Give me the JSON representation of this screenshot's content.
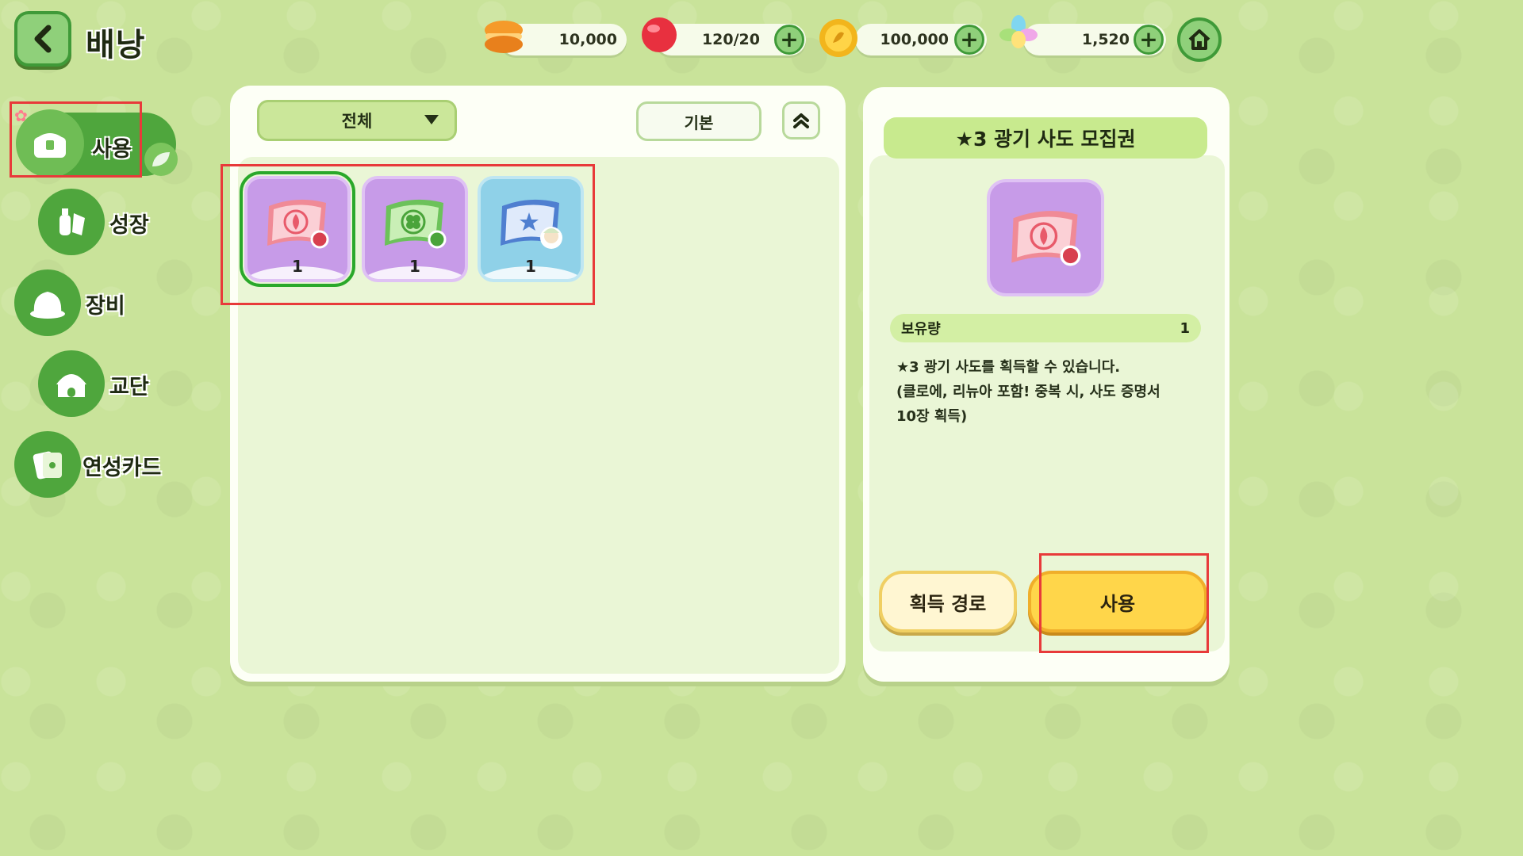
{
  "header": {
    "title": "배낭",
    "back_icon": "chevron-left-icon",
    "home_icon": "home-icon"
  },
  "currencies": [
    {
      "name": "macaron",
      "icon": "macaron-icon",
      "value": "10,000",
      "has_plus": false
    },
    {
      "name": "red-candy",
      "icon": "red-candy-icon",
      "value": "120/20",
      "has_plus": true
    },
    {
      "name": "gold-coin",
      "icon": "gold-coin-icon",
      "value": "100,000",
      "has_plus": true
    },
    {
      "name": "crystal",
      "icon": "crystal-flower-icon",
      "value": "1,520",
      "has_plus": true
    }
  ],
  "sidebar": {
    "items": [
      {
        "label": "사용",
        "icon": "chest-icon",
        "active": true
      },
      {
        "label": "성장",
        "icon": "potion-icon",
        "active": false
      },
      {
        "label": "장비",
        "icon": "hat-icon",
        "active": false
      },
      {
        "label": "교단",
        "icon": "temple-icon",
        "active": false
      },
      {
        "label": "연성카드",
        "icon": "cards-icon",
        "active": false
      }
    ]
  },
  "toolbar": {
    "filter_label": "전체",
    "sort_label": "기본"
  },
  "inventory": {
    "items": [
      {
        "icon": "fire-ticket-icon",
        "count": "1",
        "selected": true,
        "color": "#c79be8"
      },
      {
        "icon": "clover-ticket-icon",
        "count": "1",
        "selected": false,
        "color": "#c79be8"
      },
      {
        "icon": "star-ticket-icon",
        "count": "1",
        "selected": false,
        "color": "#8fd1e8"
      }
    ]
  },
  "detail": {
    "title": "★3 광기 사도 모집권",
    "qty_label": "보유량",
    "qty_value": "1",
    "desc_line1": "★3 광기 사도를 획득할 수 있습니다.",
    "desc_line2": "(클로에, 리뉴아 포함! 중복 시, 사도 증명서",
    "desc_line3": "10장 획득)",
    "source_button": "획득 경로",
    "use_button": "사용"
  },
  "colors": {
    "background": "#c9e39a",
    "accent_green": "#4fa63d",
    "highlight_frame": "#e83a3a",
    "use_button": "#ffd64a"
  }
}
